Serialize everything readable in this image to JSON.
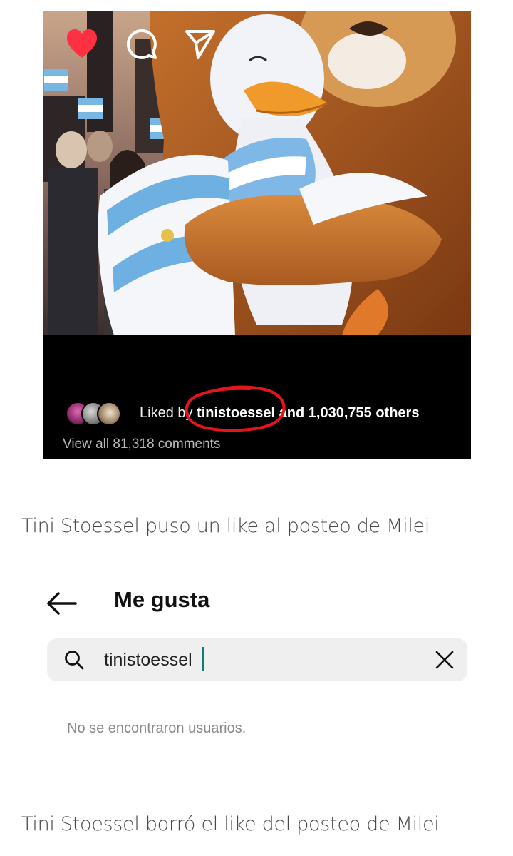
{
  "post": {
    "likes_prefix": "Liked by ",
    "liked_user": "tinistoessel",
    "likes_and": " and ",
    "likes_others": "1,030,755 others",
    "view_comments": "View all 81,318 comments",
    "accent_like_color": "#ff3040",
    "annotation_color": "#e8141c"
  },
  "captions": {
    "first": "Tini Stoessel puso un like al posteo de Milei",
    "second": "Tini Stoessel borró el like del posteo de Milei"
  },
  "likes_screen": {
    "title": "Me gusta",
    "search_value": "tinistoessel",
    "empty_message": "No se encontraron usuarios."
  },
  "icons": {
    "like": "heart-icon",
    "comment": "comment-icon",
    "share": "share-icon",
    "back": "back-arrow-icon",
    "search": "search-icon",
    "clear": "close-icon"
  }
}
